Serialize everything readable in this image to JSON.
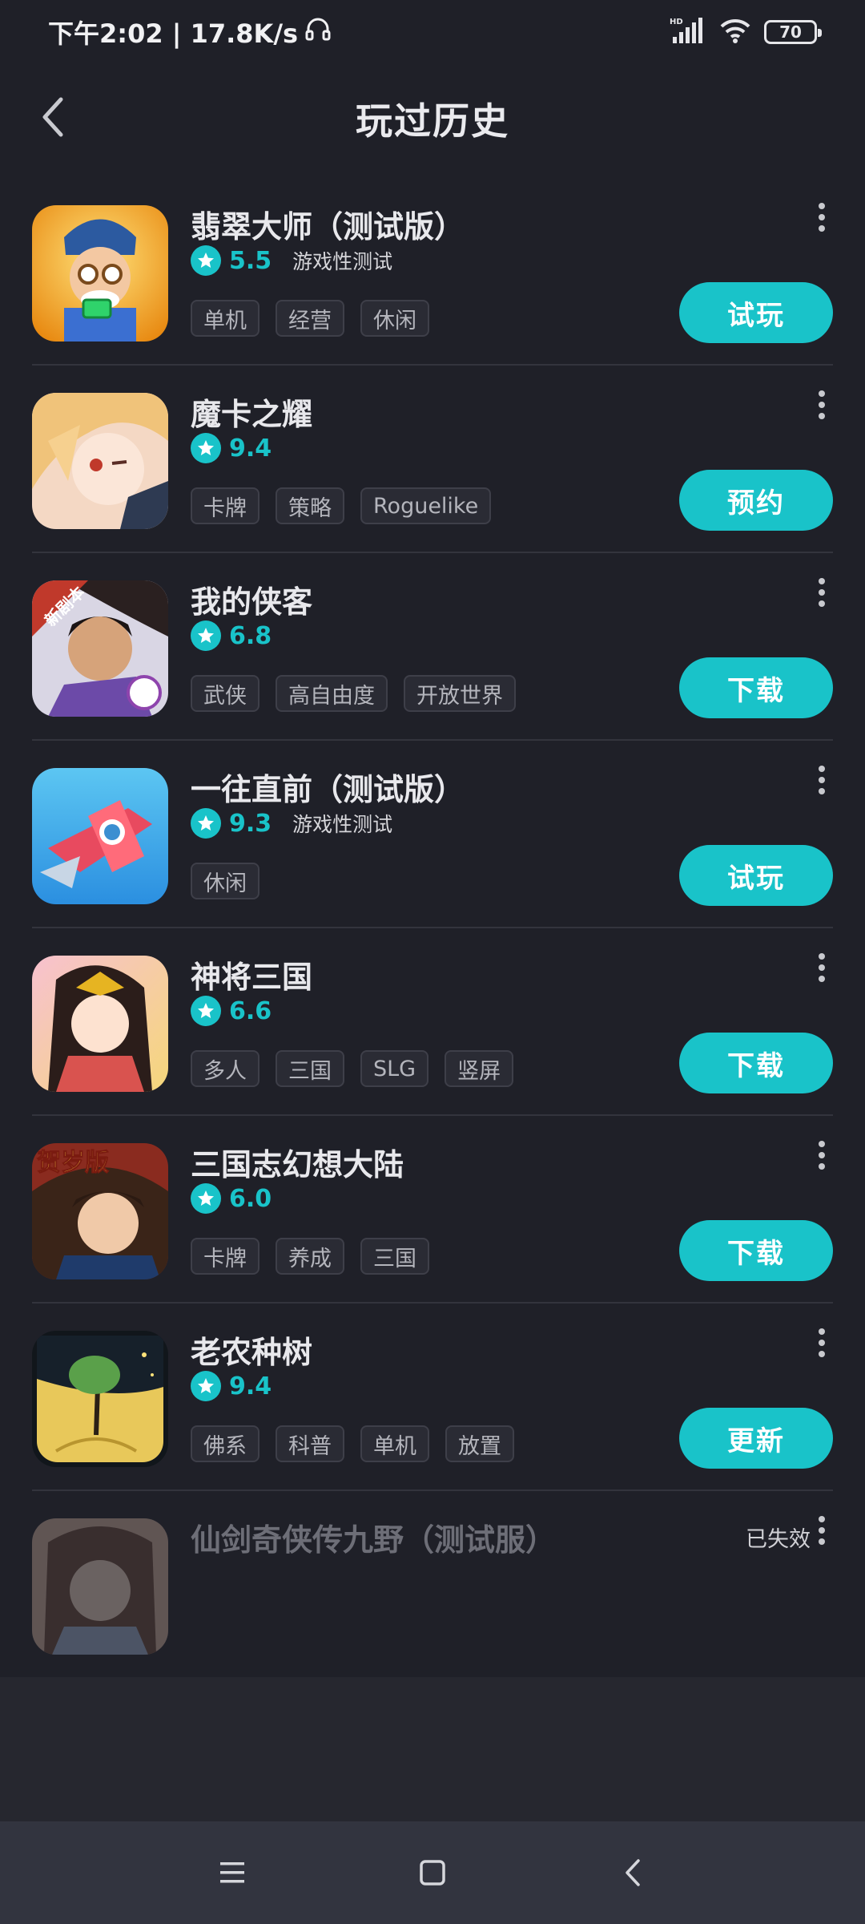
{
  "status_bar": {
    "time_text": "下午2:02 | 17.8K/s",
    "battery": "70",
    "icons": [
      "headset-icon",
      "signal-icon",
      "wifi-icon",
      "battery-icon"
    ]
  },
  "header": {
    "title": "玩过历史",
    "back_icon": "chevron-left-icon"
  },
  "colors": {
    "accent": "#19c3c9",
    "background": "#1f2028",
    "tag_border": "#3e3f49"
  },
  "games": [
    {
      "name": "翡翠大师（测试版）",
      "rating": "5.5",
      "note": "游戏性测试",
      "tags": [
        "单机",
        "经营",
        "休闲"
      ],
      "action": "试玩",
      "icon": "jade-master-game-icon"
    },
    {
      "name": "魔卡之耀",
      "rating": "9.4",
      "note": "",
      "tags": [
        "卡牌",
        "策略",
        "Roguelike"
      ],
      "action": "预约",
      "icon": "anime-girl-game-icon"
    },
    {
      "name": "我的侠客",
      "rating": "6.8",
      "note": "",
      "tags": [
        "武侠",
        "高自由度",
        "开放世界"
      ],
      "action": "下载",
      "icon": "swordsman-game-icon",
      "icon_banner": "新剧本"
    },
    {
      "name": "一往直前（测试版）",
      "rating": "9.3",
      "note": "游戏性测试",
      "tags": [
        "休闲"
      ],
      "action": "试玩",
      "icon": "airplane-game-icon"
    },
    {
      "name": "神将三国",
      "rating": "6.6",
      "note": "",
      "tags": [
        "多人",
        "三国",
        "SLG",
        "竖屏"
      ],
      "action": "下载",
      "icon": "general-girl-game-icon"
    },
    {
      "name": "三国志幻想大陆",
      "rating": "6.0",
      "note": "",
      "tags": [
        "卡牌",
        "养成",
        "三国"
      ],
      "action": "下载",
      "icon": "three-kingdoms-warrior-game-icon",
      "icon_banner": "贺岁版"
    },
    {
      "name": "老农种树",
      "rating": "9.4",
      "note": "",
      "tags": [
        "佛系",
        "科普",
        "单机",
        "放置"
      ],
      "action": "更新",
      "icon": "tree-game-icon"
    },
    {
      "name": "仙剑奇侠传九野（测试服）",
      "status": "已失效",
      "icon": "xianjian-game-icon"
    }
  ],
  "nav": {
    "icons": [
      "menu-icon",
      "home-square-icon",
      "back-icon"
    ]
  }
}
